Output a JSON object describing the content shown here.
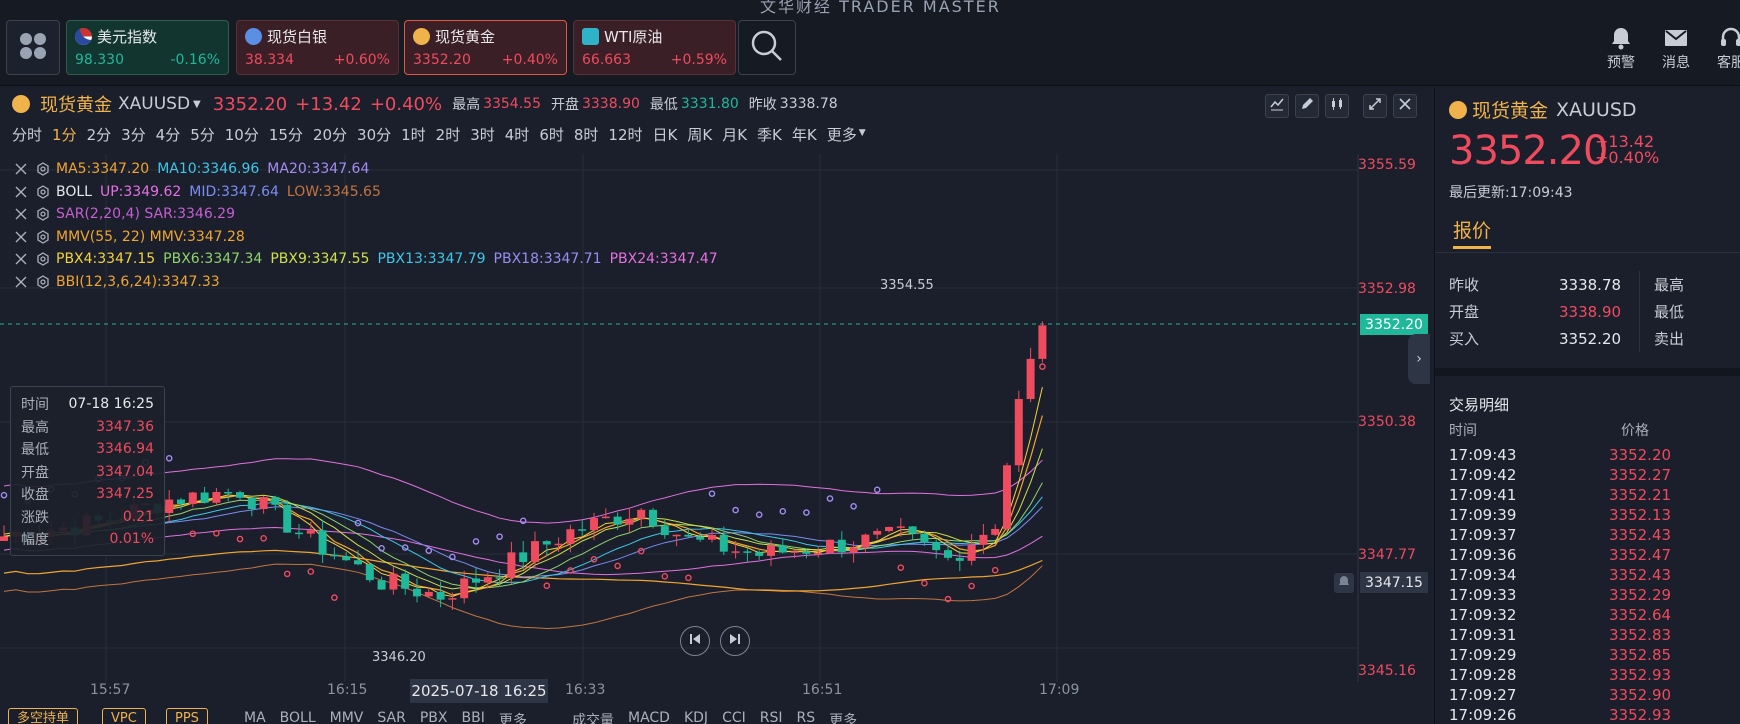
{
  "app": {
    "title": "文华财经 TRADER MASTER"
  },
  "tickers": [
    {
      "name": "美元指数",
      "price": "98.330",
      "change": "-0.16%",
      "dir": "down"
    },
    {
      "name": "现货白银",
      "price": "38.334",
      "change": "+0.60%",
      "dir": "up"
    },
    {
      "name": "现货黄金",
      "price": "3352.20",
      "change": "+0.40%",
      "dir": "up"
    },
    {
      "name": "WTI原油",
      "price": "66.663",
      "change": "+0.59%",
      "dir": "up"
    }
  ],
  "top_actions": {
    "alert": "预警",
    "message": "消息",
    "service": "客服"
  },
  "chart_header": {
    "name": "现货黄金",
    "code": "XAUUSD",
    "price": "3352.20",
    "change": "+13.42",
    "change_pct": "+0.40%",
    "high_label": "最高",
    "high": "3354.55",
    "open_label": "开盘",
    "open": "3338.90",
    "low_label": "最低",
    "low": "3331.80",
    "prev_label": "昨收",
    "prev": "3338.78"
  },
  "periods": [
    "分时",
    "1分",
    "2分",
    "3分",
    "4分",
    "5分",
    "10分",
    "15分",
    "20分",
    "30分",
    "1时",
    "2时",
    "3时",
    "4时",
    "6时",
    "8时",
    "12时",
    "日K",
    "周K",
    "月K",
    "季K",
    "年K",
    "更多"
  ],
  "active_period": "1分",
  "indicators": [
    [
      {
        "t": "MA5:3347.20",
        "c": "#f0a531"
      },
      {
        "t": "MA10:3346.96",
        "c": "#3fc6e8"
      },
      {
        "t": "MA20:3347.64",
        "c": "#a48cf2"
      }
    ],
    [
      {
        "t": "BOLL",
        "c": "#e6e8ec"
      },
      {
        "t": "UP:3349.62",
        "c": "#e470e0"
      },
      {
        "t": "MID:3347.64",
        "c": "#7b8cf2"
      },
      {
        "t": "LOW:3345.65",
        "c": "#c2753e"
      }
    ],
    [
      {
        "t": "SAR(2,20,4) SAR:3346.29",
        "c": "#c75ed2"
      }
    ],
    [
      {
        "t": "MMV(55, 22) MMV:3347.28",
        "c": "#f0a531"
      }
    ],
    [
      {
        "t": "PBX4:3347.15",
        "c": "#f5d33a"
      },
      {
        "t": "PBX6:3347.34",
        "c": "#8fd46b"
      },
      {
        "t": "PBX9:3347.55",
        "c": "#cfe04a"
      },
      {
        "t": "PBX13:3347.79",
        "c": "#3fc6e8"
      },
      {
        "t": "PBX18:3347.71",
        "c": "#9a8cf2"
      },
      {
        "t": "PBX24:3347.47",
        "c": "#e470e0"
      }
    ],
    [
      {
        "t": "BBI(12,3,6,24):3347.33",
        "c": "#f0a531"
      }
    ]
  ],
  "tooltip": [
    {
      "label": "时间",
      "value": "07-18 16:25"
    },
    {
      "label": "最高",
      "value": "3347.36"
    },
    {
      "label": "最低",
      "value": "3346.94"
    },
    {
      "label": "开盘",
      "value": "3347.04"
    },
    {
      "label": "收盘",
      "value": "3347.25"
    },
    {
      "label": "涨跌",
      "value": "0.21"
    },
    {
      "label": "幅度",
      "value": "0.01%"
    }
  ],
  "y_axis": [
    "3355.59",
    "3352.98",
    "3350.38",
    "3347.77",
    "3345.16"
  ],
  "price_tags": {
    "current": "3352.20",
    "cursor": "3347.15",
    "high_mark": "3354.55",
    "low_mark": "3346.20"
  },
  "x_axis": [
    "15:57",
    "16:15",
    "16:33",
    "16:51",
    "17:09"
  ],
  "x_highlight": "2025-07-18 16:25",
  "bottom_bar": {
    "buttons": [
      "多空持单",
      "VPC",
      "PPS"
    ],
    "main_inds": [
      "MA",
      "BOLL",
      "MMV",
      "SAR",
      "PBX",
      "BBI",
      "更多"
    ],
    "sub_inds": [
      "成交量",
      "MACD",
      "KDJ",
      "CCI",
      "RSI",
      "RS",
      "更多"
    ]
  },
  "right": {
    "name": "现货黄金",
    "code": "XAUUSD",
    "price": "3352.20",
    "change": "+13.42",
    "change_pct": "+0.40%",
    "updated": "最后更新:17:09:43",
    "tab": "报价",
    "quote_rows": [
      {
        "l1": "昨收",
        "v1": "3338.78",
        "l2": "最高"
      },
      {
        "l1": "开盘",
        "v1": "3338.90",
        "l2": "最低"
      },
      {
        "l1": "买入",
        "v1": "3352.20",
        "l2": "卖出"
      }
    ],
    "trades_title": "交易明细",
    "trades_cols": {
      "time": "时间",
      "price": "价格"
    },
    "trades": [
      {
        "t": "17:09:43",
        "p": "3352.20"
      },
      {
        "t": "17:09:42",
        "p": "3352.27"
      },
      {
        "t": "17:09:41",
        "p": "3352.21"
      },
      {
        "t": "17:09:39",
        "p": "3352.13"
      },
      {
        "t": "17:09:37",
        "p": "3352.43"
      },
      {
        "t": "17:09:36",
        "p": "3352.47"
      },
      {
        "t": "17:09:34",
        "p": "3352.43"
      },
      {
        "t": "17:09:33",
        "p": "3352.29"
      },
      {
        "t": "17:09:32",
        "p": "3352.64"
      },
      {
        "t": "17:09:31",
        "p": "3352.83"
      },
      {
        "t": "17:09:29",
        "p": "3352.85"
      },
      {
        "t": "17:09:28",
        "p": "3352.93"
      },
      {
        "t": "17:09:27",
        "p": "3352.90"
      },
      {
        "t": "17:09:26",
        "p": "3352.93"
      }
    ]
  },
  "colors": {
    "up": "#ef4b5e",
    "down": "#1fb89a",
    "accent": "#f0b24a",
    "bg": "#1a1f2b"
  }
}
